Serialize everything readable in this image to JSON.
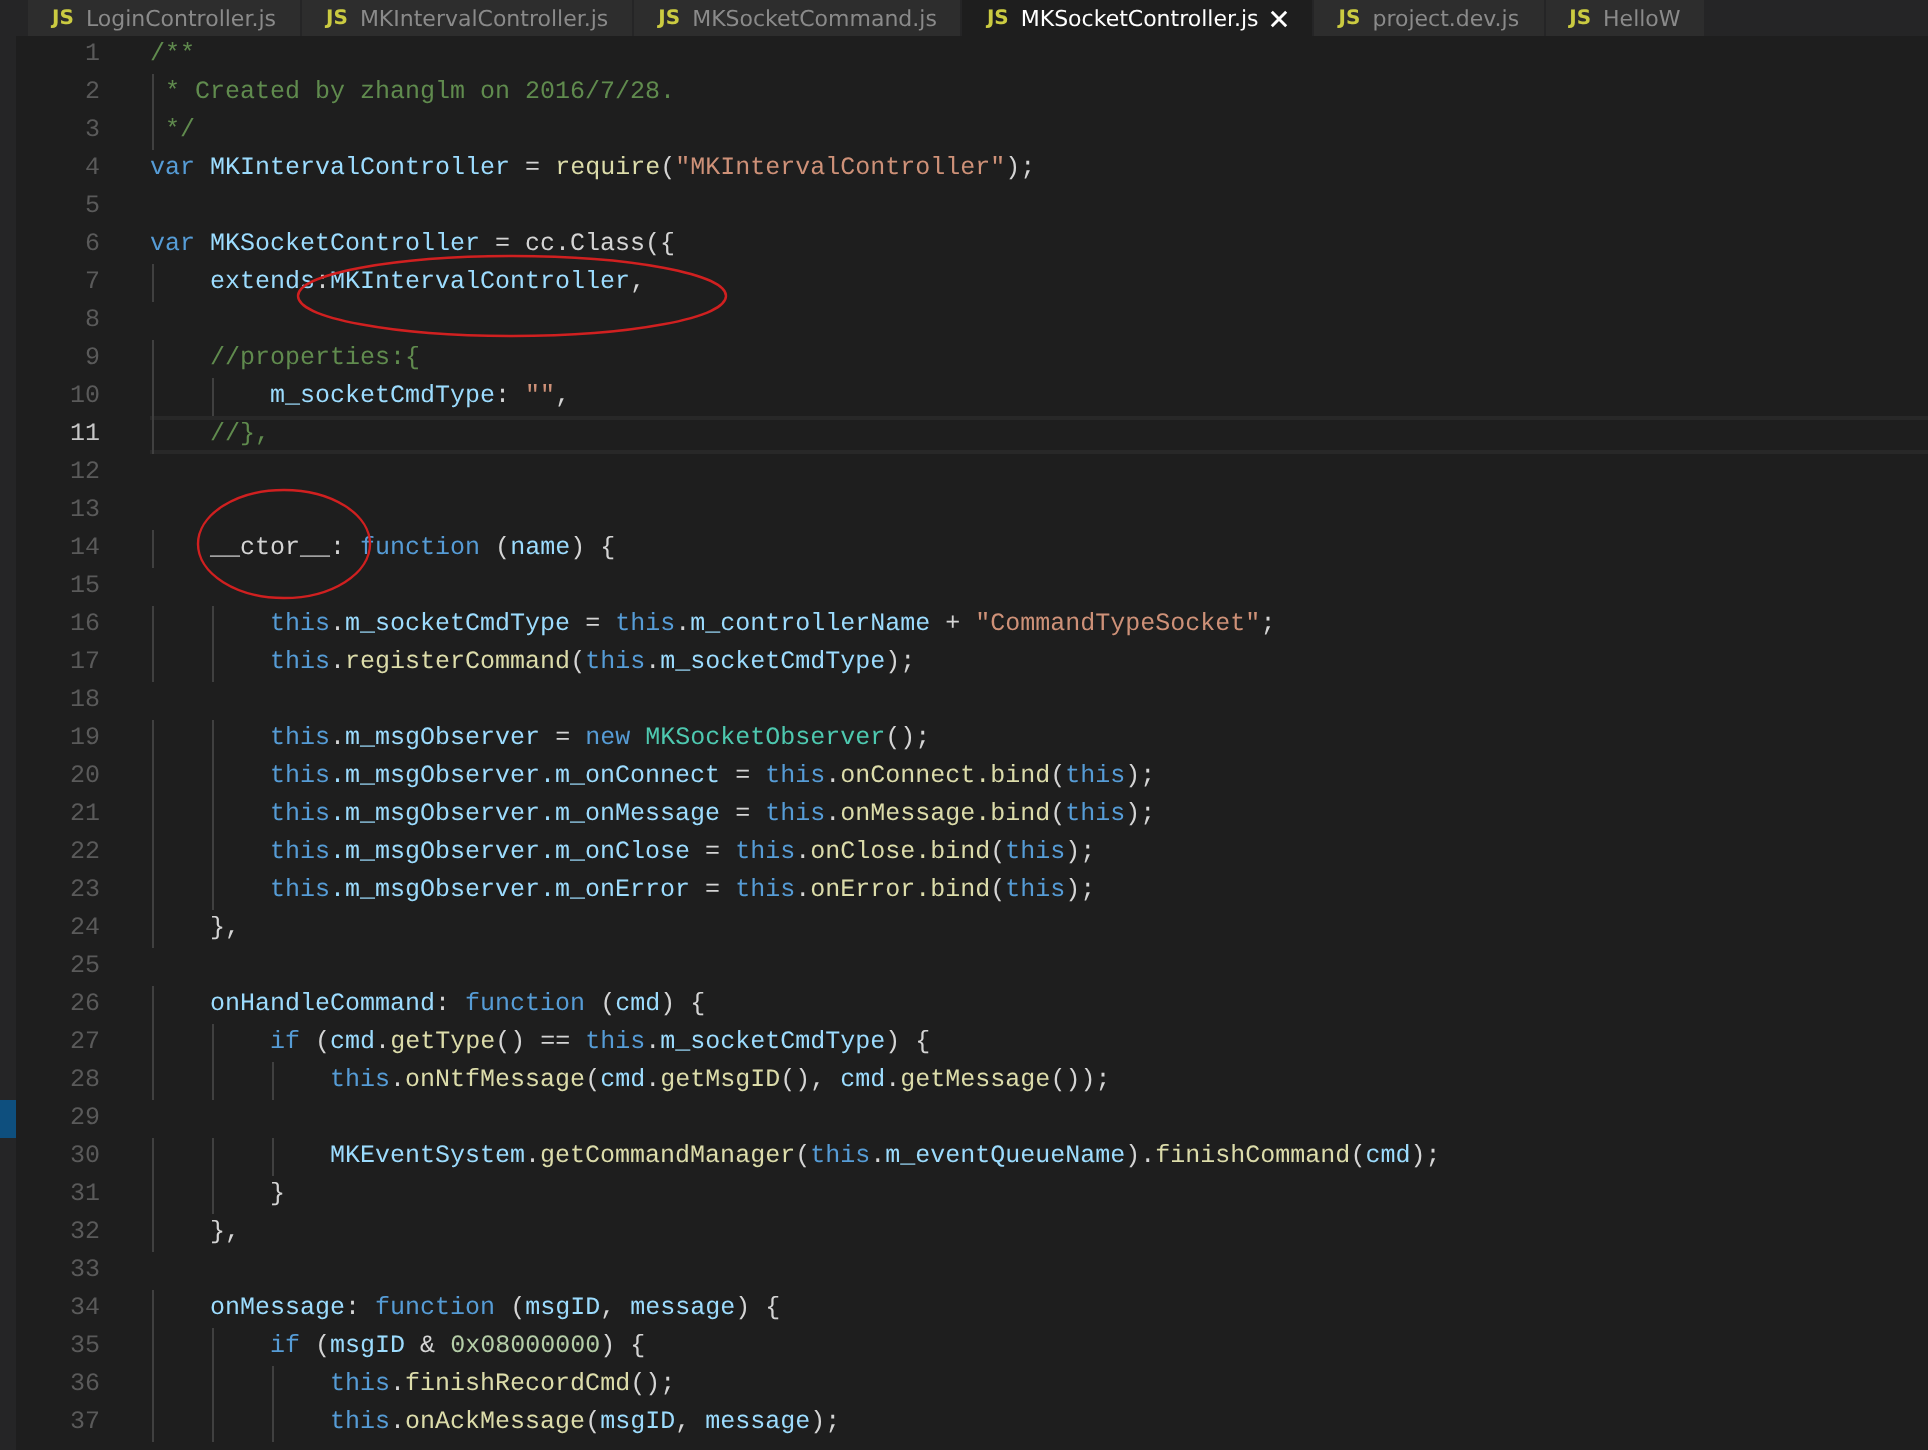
{
  "tabs": [
    {
      "icon_text": "JS",
      "label": "LoginController.js",
      "selected": false
    },
    {
      "icon_text": "JS",
      "label": "MKIntervalController.js",
      "selected": false
    },
    {
      "icon_text": "JS",
      "label": "MKSocketCommand.js",
      "selected": false
    },
    {
      "icon_text": "JS",
      "label": "MKSocketController.js",
      "selected": true
    },
    {
      "icon_text": "JS",
      "label": "project.dev.js",
      "selected": false
    },
    {
      "icon_text": "JS",
      "label": "HelloW",
      "selected": false
    }
  ],
  "editor": {
    "lines": [
      {
        "number": "1",
        "current": false,
        "tokens": [
          {
            "kind": "comment",
            "text": "/**"
          }
        ]
      },
      {
        "number": "2",
        "current": false,
        "tokens": [
          {
            "kind": "comment",
            "text": " * Created by zhanglm on 2016/7/28."
          }
        ]
      },
      {
        "number": "3",
        "current": false,
        "tokens": [
          {
            "kind": "comment",
            "text": " */"
          }
        ]
      },
      {
        "number": "4",
        "current": false,
        "tokens": [
          {
            "kind": "keyword",
            "text": "var "
          },
          {
            "kind": "variable",
            "text": "MKIntervalController"
          },
          {
            "kind": "plain",
            "text": " = "
          },
          {
            "kind": "function",
            "text": "require"
          },
          {
            "kind": "plain",
            "text": "("
          },
          {
            "kind": "string",
            "text": "\"MKIntervalController\""
          },
          {
            "kind": "plain",
            "text": ");"
          }
        ]
      },
      {
        "number": "5",
        "current": false
      },
      {
        "number": "6",
        "current": false,
        "tokens": [
          {
            "kind": "keyword",
            "text": "var "
          },
          {
            "kind": "variable",
            "text": "MKSocketController"
          },
          {
            "kind": "plain",
            "text": " = cc.Class({"
          }
        ]
      },
      {
        "number": "7",
        "current": false,
        "tokens": [
          {
            "kind": "variable",
            "text": "    extends"
          },
          {
            "kind": "plain",
            "text": ":"
          },
          {
            "kind": "variable",
            "text": "MKIntervalController"
          },
          {
            "kind": "plain",
            "text": ","
          }
        ]
      },
      {
        "number": "8",
        "current": false
      },
      {
        "number": "9",
        "current": false,
        "tokens": [
          {
            "kind": "comment",
            "text": "    //properties:{"
          }
        ]
      },
      {
        "number": "10",
        "current": false,
        "tokens": [
          {
            "kind": "variable",
            "text": "        m_socketCmdType"
          },
          {
            "kind": "plain",
            "text": ": "
          },
          {
            "kind": "string",
            "text": "\"\""
          },
          {
            "kind": "plain",
            "text": ","
          }
        ]
      },
      {
        "number": "11",
        "current": true,
        "tokens": [
          {
            "kind": "comment",
            "text": "    //},"
          }
        ]
      },
      {
        "number": "12",
        "current": false
      },
      {
        "number": "13",
        "current": false
      },
      {
        "number": "14",
        "current": false,
        "tokens": [
          {
            "kind": "plain",
            "text": "    __ctor__: "
          },
          {
            "kind": "keyword",
            "text": "function"
          },
          {
            "kind": "plain",
            "text": " ("
          },
          {
            "kind": "variable",
            "text": "name"
          },
          {
            "kind": "plain",
            "text": ") {"
          }
        ]
      },
      {
        "number": "15",
        "current": false
      },
      {
        "number": "16",
        "current": false,
        "tokens": [
          {
            "kind": "keyword",
            "text": "        this"
          },
          {
            "kind": "plain",
            "text": "."
          },
          {
            "kind": "variable",
            "text": "m_socketCmdType"
          },
          {
            "kind": "plain",
            "text": " = "
          },
          {
            "kind": "keyword",
            "text": "this"
          },
          {
            "kind": "plain",
            "text": "."
          },
          {
            "kind": "variable",
            "text": "m_controllerName"
          },
          {
            "kind": "plain",
            "text": " + "
          },
          {
            "kind": "string",
            "text": "\"CommandTypeSocket\""
          },
          {
            "kind": "plain",
            "text": ";"
          }
        ]
      },
      {
        "number": "17",
        "current": false,
        "tokens": [
          {
            "kind": "keyword",
            "text": "        this"
          },
          {
            "kind": "plain",
            "text": "."
          },
          {
            "kind": "function",
            "text": "registerCommand"
          },
          {
            "kind": "plain",
            "text": "("
          },
          {
            "kind": "keyword",
            "text": "this"
          },
          {
            "kind": "plain",
            "text": "."
          },
          {
            "kind": "variable",
            "text": "m_socketCmdType"
          },
          {
            "kind": "plain",
            "text": ");"
          }
        ]
      },
      {
        "number": "18",
        "current": false
      },
      {
        "number": "19",
        "current": false,
        "tokens": [
          {
            "kind": "keyword",
            "text": "        this"
          },
          {
            "kind": "plain",
            "text": "."
          },
          {
            "kind": "variable",
            "text": "m_msgObserver"
          },
          {
            "kind": "plain",
            "text": " = "
          },
          {
            "kind": "keyword",
            "text": "new "
          },
          {
            "kind": "class",
            "text": "MKSocketObserver"
          },
          {
            "kind": "plain",
            "text": "();"
          }
        ]
      },
      {
        "number": "20",
        "current": false,
        "tokens": [
          {
            "kind": "keyword",
            "text": "        this"
          },
          {
            "kind": "variable",
            "text": ".m_msgObserver.m_onConnect"
          },
          {
            "kind": "plain",
            "text": " = "
          },
          {
            "kind": "keyword",
            "text": "this"
          },
          {
            "kind": "plain",
            "text": "."
          },
          {
            "kind": "function",
            "text": "onConnect.bind"
          },
          {
            "kind": "plain",
            "text": "("
          },
          {
            "kind": "keyword",
            "text": "this"
          },
          {
            "kind": "plain",
            "text": ");"
          }
        ]
      },
      {
        "number": "21",
        "current": false,
        "tokens": [
          {
            "kind": "keyword",
            "text": "        this"
          },
          {
            "kind": "variable",
            "text": ".m_msgObserver.m_onMessage"
          },
          {
            "kind": "plain",
            "text": " = "
          },
          {
            "kind": "keyword",
            "text": "this"
          },
          {
            "kind": "plain",
            "text": "."
          },
          {
            "kind": "function",
            "text": "onMessage.bind"
          },
          {
            "kind": "plain",
            "text": "("
          },
          {
            "kind": "keyword",
            "text": "this"
          },
          {
            "kind": "plain",
            "text": ");"
          }
        ]
      },
      {
        "number": "22",
        "current": false,
        "tokens": [
          {
            "kind": "keyword",
            "text": "        this"
          },
          {
            "kind": "variable",
            "text": ".m_msgObserver.m_onClose"
          },
          {
            "kind": "plain",
            "text": " = "
          },
          {
            "kind": "keyword",
            "text": "this"
          },
          {
            "kind": "plain",
            "text": "."
          },
          {
            "kind": "function",
            "text": "onClose.bind"
          },
          {
            "kind": "plain",
            "text": "("
          },
          {
            "kind": "keyword",
            "text": "this"
          },
          {
            "kind": "plain",
            "text": ");"
          }
        ]
      },
      {
        "number": "23",
        "current": false,
        "tokens": [
          {
            "kind": "keyword",
            "text": "        this"
          },
          {
            "kind": "variable",
            "text": ".m_msgObserver.m_onError"
          },
          {
            "kind": "plain",
            "text": " = "
          },
          {
            "kind": "keyword",
            "text": "this"
          },
          {
            "kind": "plain",
            "text": "."
          },
          {
            "kind": "function",
            "text": "onError.bind"
          },
          {
            "kind": "plain",
            "text": "("
          },
          {
            "kind": "keyword",
            "text": "this"
          },
          {
            "kind": "plain",
            "text": ");"
          }
        ]
      },
      {
        "number": "24",
        "current": false,
        "tokens": [
          {
            "kind": "plain",
            "text": "    },"
          }
        ]
      },
      {
        "number": "25",
        "current": false
      },
      {
        "number": "26",
        "current": false,
        "tokens": [
          {
            "kind": "variable",
            "text": "    onHandleCommand"
          },
          {
            "kind": "plain",
            "text": ": "
          },
          {
            "kind": "keyword",
            "text": "function"
          },
          {
            "kind": "plain",
            "text": " ("
          },
          {
            "kind": "variable",
            "text": "cmd"
          },
          {
            "kind": "plain",
            "text": ") {"
          }
        ]
      },
      {
        "number": "27",
        "current": false,
        "tokens": [
          {
            "kind": "keyword",
            "text": "        if"
          },
          {
            "kind": "plain",
            "text": " ("
          },
          {
            "kind": "variable",
            "text": "cmd"
          },
          {
            "kind": "plain",
            "text": "."
          },
          {
            "kind": "function",
            "text": "getType"
          },
          {
            "kind": "plain",
            "text": "() == "
          },
          {
            "kind": "keyword",
            "text": "this"
          },
          {
            "kind": "plain",
            "text": "."
          },
          {
            "kind": "variable",
            "text": "m_socketCmdType"
          },
          {
            "kind": "plain",
            "text": ") {"
          }
        ]
      },
      {
        "number": "28",
        "current": false,
        "tokens": [
          {
            "kind": "keyword",
            "text": "            this"
          },
          {
            "kind": "plain",
            "text": "."
          },
          {
            "kind": "function",
            "text": "onNtfMessage"
          },
          {
            "kind": "plain",
            "text": "("
          },
          {
            "kind": "variable",
            "text": "cmd"
          },
          {
            "kind": "plain",
            "text": "."
          },
          {
            "kind": "function",
            "text": "getMsgID"
          },
          {
            "kind": "plain",
            "text": "(), "
          },
          {
            "kind": "variable",
            "text": "cmd"
          },
          {
            "kind": "plain",
            "text": "."
          },
          {
            "kind": "function",
            "text": "getMessage"
          },
          {
            "kind": "plain",
            "text": "());"
          }
        ]
      },
      {
        "number": "29",
        "current": false
      },
      {
        "number": "30",
        "current": false,
        "tokens": [
          {
            "kind": "variable",
            "text": "            MKEventSystem"
          },
          {
            "kind": "plain",
            "text": "."
          },
          {
            "kind": "function",
            "text": "getCommandManager"
          },
          {
            "kind": "plain",
            "text": "("
          },
          {
            "kind": "keyword",
            "text": "this"
          },
          {
            "kind": "plain",
            "text": "."
          },
          {
            "kind": "variable",
            "text": "m_eventQueueName"
          },
          {
            "kind": "plain",
            "text": ")."
          },
          {
            "kind": "function",
            "text": "finishCommand"
          },
          {
            "kind": "plain",
            "text": "("
          },
          {
            "kind": "variable",
            "text": "cmd"
          },
          {
            "kind": "plain",
            "text": ");"
          }
        ]
      },
      {
        "number": "31",
        "current": false,
        "tokens": [
          {
            "kind": "plain",
            "text": "        }"
          }
        ]
      },
      {
        "number": "32",
        "current": false,
        "tokens": [
          {
            "kind": "plain",
            "text": "    },"
          }
        ]
      },
      {
        "number": "33",
        "current": false
      },
      {
        "number": "34",
        "current": false,
        "tokens": [
          {
            "kind": "variable",
            "text": "    onMessage"
          },
          {
            "kind": "plain",
            "text": ": "
          },
          {
            "kind": "keyword",
            "text": "function"
          },
          {
            "kind": "plain",
            "text": " ("
          },
          {
            "kind": "variable",
            "text": "msgID"
          },
          {
            "kind": "plain",
            "text": ", "
          },
          {
            "kind": "variable",
            "text": "message"
          },
          {
            "kind": "plain",
            "text": ") {"
          }
        ]
      },
      {
        "number": "35",
        "current": false,
        "tokens": [
          {
            "kind": "keyword",
            "text": "        if"
          },
          {
            "kind": "plain",
            "text": " ("
          },
          {
            "kind": "variable",
            "text": "msgID"
          },
          {
            "kind": "plain",
            "text": " & "
          },
          {
            "kind": "number",
            "text": "0x08000000"
          },
          {
            "kind": "plain",
            "text": ") {"
          }
        ]
      },
      {
        "number": "36",
        "current": false,
        "tokens": [
          {
            "kind": "keyword",
            "text": "            this"
          },
          {
            "kind": "plain",
            "text": "."
          },
          {
            "kind": "function",
            "text": "finishRecordCmd"
          },
          {
            "kind": "plain",
            "text": "();"
          }
        ]
      },
      {
        "number": "37",
        "current": false,
        "tokens": [
          {
            "kind": "keyword",
            "text": "            this"
          },
          {
            "kind": "plain",
            "text": "."
          },
          {
            "kind": "function",
            "text": "onAckMessage"
          },
          {
            "kind": "plain",
            "text": "("
          },
          {
            "kind": "variable",
            "text": "msgID"
          },
          {
            "kind": "plain",
            "text": ", "
          },
          {
            "kind": "variable",
            "text": "message"
          },
          {
            "kind": "plain",
            "text": ");"
          }
        ]
      }
    ]
  }
}
